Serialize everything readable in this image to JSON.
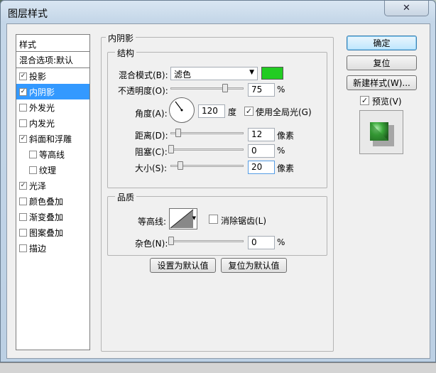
{
  "window": {
    "title": "图层样式",
    "close_icon": "✕"
  },
  "stylelist": {
    "header": "样式",
    "blend": "混合选项:默认",
    "items": [
      {
        "label": "投影",
        "checked": true
      },
      {
        "label": "内阴影",
        "checked": true,
        "selected": true
      },
      {
        "label": "外发光",
        "checked": false
      },
      {
        "label": "内发光",
        "checked": false
      },
      {
        "label": "斜面和浮雕",
        "checked": true
      },
      {
        "label": "等高线",
        "checked": false,
        "indent": true
      },
      {
        "label": "纹理",
        "checked": false,
        "indent": true
      },
      {
        "label": "光泽",
        "checked": true
      },
      {
        "label": "颜色叠加",
        "checked": false
      },
      {
        "label": "渐变叠加",
        "checked": false
      },
      {
        "label": "图案叠加",
        "checked": false
      },
      {
        "label": "描边",
        "checked": false
      }
    ]
  },
  "panel": {
    "title": "内阴影",
    "structure": {
      "title": "结构",
      "blend_mode_label": "混合模式(B):",
      "blend_mode_value": "滤色",
      "color": "#22cc22",
      "opacity_label": "不透明度(O):",
      "opacity_value": "75",
      "opacity_unit": "%",
      "opacity_level": 0.75,
      "angle_label": "角度(A):",
      "angle_value": "120",
      "angle_unit": "度",
      "global_light_label": "使用全局光(G)",
      "global_light_checked": "✓",
      "distance_label": "距离(D):",
      "distance_value": "12",
      "distance_unit": "像素",
      "choke_label": "阻塞(C):",
      "choke_value": "0",
      "choke_unit": "%",
      "size_label": "大小(S):",
      "size_value": "20",
      "size_unit": "像素"
    },
    "quality": {
      "title": "品质",
      "contour_label": "等高线:",
      "antialias_label": "消除锯齿(L)",
      "noise_label": "杂色(N):",
      "noise_value": "0",
      "noise_unit": "%"
    },
    "set_default": "设置为默认值",
    "reset_default": "复位为默认值"
  },
  "buttons": {
    "ok": "确定",
    "reset": "复位",
    "new_style": "新建样式(W)...",
    "preview_label": "预览(V)",
    "preview_checked": "✓"
  }
}
